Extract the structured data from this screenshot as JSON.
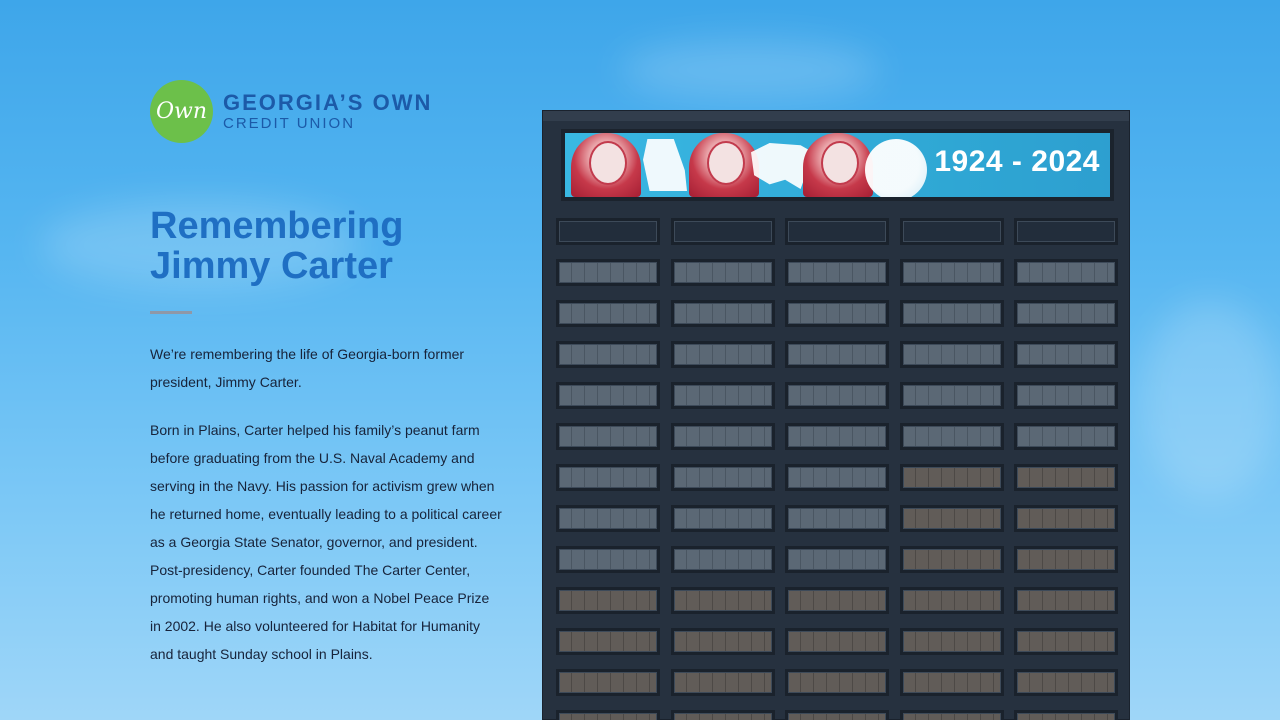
{
  "logo": {
    "badge_text": "Own",
    "line1": "GEORGIA’S OWN",
    "line2": "CREDIT UNION"
  },
  "article": {
    "title_line1": "Remembering",
    "title_line2": "Jimmy Carter",
    "paragraph1": "We’re remembering the life of Georgia-born former president, Jimmy Carter.",
    "paragraph2": "Born in Plains, Carter helped his family’s peanut farm before graduating from the U.S. Naval Academy and serving in the Navy. His passion for activism grew when he returned home, eventually leading to a political career as a Georgia State Senator, governor, and president. Post-presidency, Carter founded The Carter Center, promoting human rights, and won a Nobel Peace Prize in 2002. He also volunteered for Habitat for Humanity and taught Sunday school in Plains."
  },
  "banner": {
    "years": "1924 - 2024"
  },
  "colors": {
    "brand_blue": "#1f6fc3",
    "brand_green": "#6cc04a",
    "building": "#26313f"
  }
}
